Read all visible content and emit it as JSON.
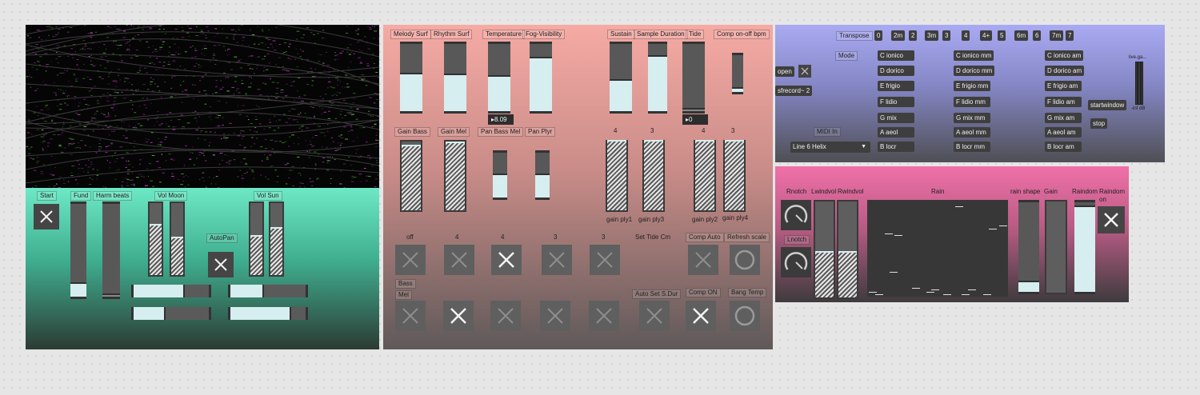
{
  "colors": {
    "green_panel_top": "#6de8c5",
    "green_panel_bottom": "#2c3b34",
    "salmon_panel_top": "#f6aaa4",
    "salmon_panel_bottom": "#5f5959",
    "blue_panel_top": "#a9aaf2",
    "blue_panel_bottom": "#4f4f55",
    "pink_panel_top": "#f070a8",
    "pink_panel_bottom": "#3e3b3d",
    "slider_fill": "#d6eef0",
    "button_bg": "#5f5f5f"
  },
  "video": {
    "name": "video-visualizer"
  },
  "panel_left": {
    "start_label": "Start",
    "fund_label": "Fund",
    "harm_label": "Harm beats",
    "vol_moon_label": "Vol Moon",
    "vol_sun_label": "Vol Sun",
    "autopan_label": "AutoPan"
  },
  "panel_mid": {
    "labels_top": [
      "Melody Surf",
      "Rhythm Surf",
      "Temperature",
      "Fog-Visibility",
      "Sustain",
      "Sample Duration",
      "Tide",
      "Comp on-off bpm"
    ],
    "temperature_value": "8.09",
    "tide_value": "0",
    "labels_gain": [
      "Gain Bass",
      "Gain Mel",
      "Pan Bass Mel",
      "Pan Plyr"
    ],
    "ply_numbers": [
      "4",
      "3",
      "4",
      "3"
    ],
    "ply_labels": [
      "gain ply1",
      "gain ply3",
      "gain ply2",
      "gain ply4"
    ],
    "row1_labels": [
      "off",
      "4",
      "4",
      "3",
      "3",
      "Set Tide Cm",
      "Comp Auto",
      "Refresh scale"
    ],
    "bass_label": "Bass",
    "mel_label": "Mel",
    "auto_set_label": "Auto Set S.Dur",
    "comp_on_label": "Comp ON",
    "bang_temp_label": "Bang Temp"
  },
  "panel_blue": {
    "transpose_label": "Transpose",
    "transpose_values": [
      "0",
      "2m",
      "2",
      "3m",
      "3",
      "4",
      "4+",
      "5",
      "6m",
      "6",
      "7m",
      "7"
    ],
    "mode_label": "Mode",
    "open_label": "open",
    "sfrecord_label": "sfrecord~ 2",
    "midi_in_label": "MIDI In",
    "midi_device": "Line 6 Helix",
    "modes_col1": [
      "C ionico",
      "D dorico",
      "E frigio",
      "F lidio",
      "G mix",
      "A aeol",
      "B locr"
    ],
    "modes_col2": [
      "C ionico mm",
      "D dorico mm",
      "E frigio mm",
      "F lidio mm",
      "G mix mm",
      "A aeol mm",
      "B locr mm"
    ],
    "modes_col3": [
      "C ionico am",
      "D dorico am",
      "E frigio am",
      "F lidio am",
      "G mix am",
      "A aeol am",
      "B locr am"
    ],
    "startwindow_label": "startwindow",
    "stop_label": "stop",
    "meter_label": "live.ga...",
    "meter_db": "-inf dB"
  },
  "panel_pink": {
    "rnotch_label": "Rnotch",
    "lnotch_label": "Lnotch",
    "lwindvol_label": "Lwindvol",
    "rwindvol_label": "Rwindvol",
    "rain_label": "Rain",
    "rain_shape_label": "rain shape",
    "gain_label": "Gain",
    "raindom_label": "Raindom",
    "raindom_on_label": "Raindom on"
  }
}
